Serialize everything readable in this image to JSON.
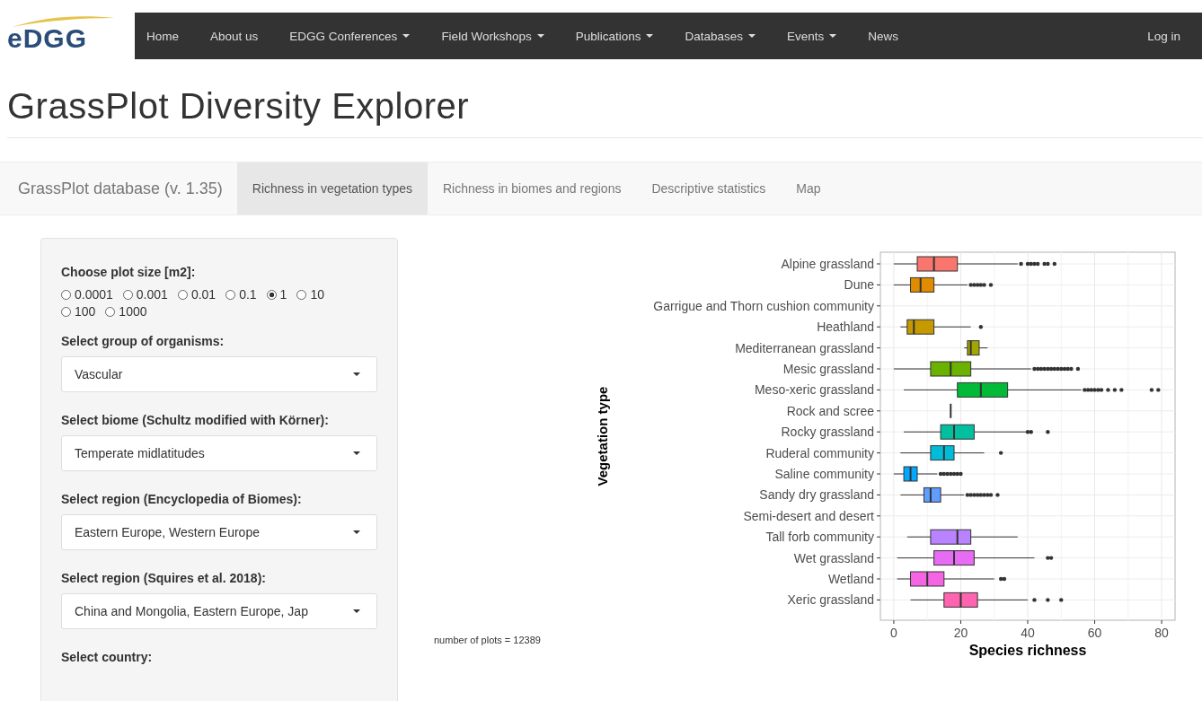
{
  "navbar": {
    "logo": "eDGG",
    "items": [
      {
        "label": "Home",
        "dropdown": false
      },
      {
        "label": "About us",
        "dropdown": false
      },
      {
        "label": "EDGG Conferences",
        "dropdown": true
      },
      {
        "label": "Field Workshops",
        "dropdown": true
      },
      {
        "label": "Publications",
        "dropdown": true
      },
      {
        "label": "Databases",
        "dropdown": true
      },
      {
        "label": "Events",
        "dropdown": true
      },
      {
        "label": "News",
        "dropdown": false
      }
    ],
    "login": "Log in"
  },
  "title": "GrassPlot Diversity Explorer",
  "tabbar": {
    "brand": "GrassPlot database (v. 1.35)",
    "tabs": [
      {
        "label": "Richness in vegetation types",
        "selected": true
      },
      {
        "label": "Richness in biomes and regions",
        "selected": false
      },
      {
        "label": "Descriptive statistics",
        "selected": false
      },
      {
        "label": "Map",
        "selected": false
      }
    ]
  },
  "sidebar": {
    "plot_size": {
      "label": "Choose plot size [m2]:",
      "options": [
        {
          "label": "0.0001",
          "selected": false
        },
        {
          "label": "0.001",
          "selected": false
        },
        {
          "label": "0.01",
          "selected": false
        },
        {
          "label": "0.1",
          "selected": false
        },
        {
          "label": "1",
          "selected": true
        },
        {
          "label": "10",
          "selected": false
        },
        {
          "label": "100",
          "selected": false
        },
        {
          "label": "1000",
          "selected": false
        }
      ]
    },
    "selects": [
      {
        "label": "Select group of organisms:",
        "value": "Vascular"
      },
      {
        "label": "Select biome (Schultz modified with Körner):",
        "value": "Temperate midlatitudes"
      },
      {
        "label": "Select region (Encyclopedia of Biomes):",
        "value": "Eastern Europe, Western Europe"
      },
      {
        "label": "Select region (Squires et al. 2018):",
        "value": "China and Mongolia, Eastern Europe, Jap"
      }
    ],
    "last_label": "Select country:"
  },
  "main": {
    "plots_count": "number of plots = 12389",
    "plot": {
      "kind": "box-plot",
      "xlabel": "Species richness",
      "ylabel": "Vegetation type",
      "xticks": [
        "0",
        "20",
        "40",
        "60",
        "80"
      ],
      "rows": [
        {
          "label": "Alpine grassland",
          "color": "#f8766d"
        },
        {
          "label": "Dune",
          "color": "#e08b00"
        },
        {
          "label": "Garrigue and Thorn cushion community"
        },
        {
          "label": "Heathland",
          "color": "#c49a00"
        },
        {
          "label": "Mediterranean grassland",
          "color": "#a3a500"
        },
        {
          "label": "Mesic grassland",
          "color": "#6bb100"
        },
        {
          "label": "Meso-xeric grassland",
          "color": "#00ba38"
        },
        {
          "label": "Rock and scree"
        },
        {
          "label": "Rocky grassland",
          "color": "#00c0a0"
        },
        {
          "label": "Ruderal community",
          "color": "#00bcd8"
        },
        {
          "label": "Saline community",
          "color": "#00a9ff"
        },
        {
          "label": "Sandy dry grassland",
          "color": "#619cff"
        },
        {
          "label": "Semi-desert and desert"
        },
        {
          "label": "Tall forb community",
          "color": "#b983ff"
        },
        {
          "label": "Wet grassland",
          "color": "#e76bf3"
        },
        {
          "label": "Wetland",
          "color": "#f564e3"
        },
        {
          "label": "Xeric grassland",
          "color": "#ff64b0"
        }
      ]
    }
  }
}
